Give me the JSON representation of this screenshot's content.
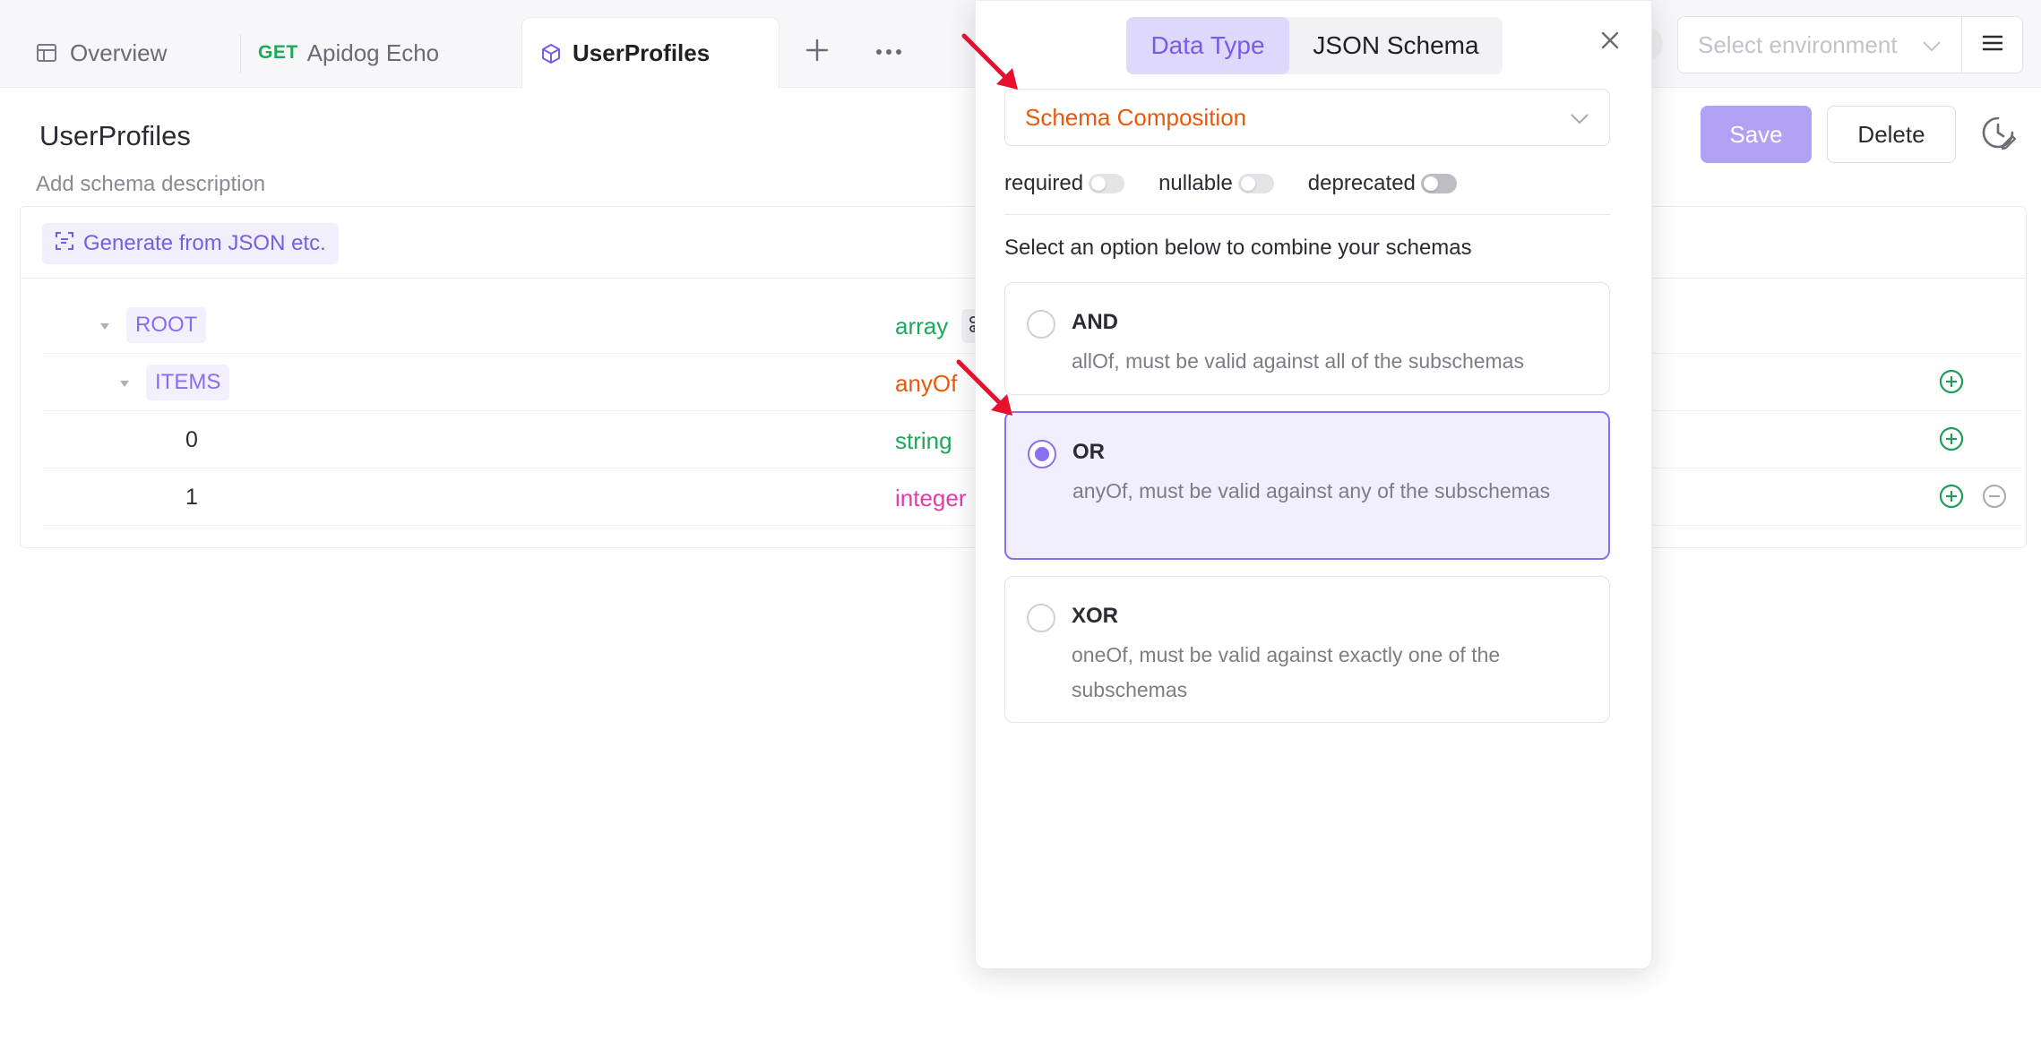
{
  "tabs": {
    "overview": "Overview",
    "echo_method": "GET",
    "echo_label": "Apidog Echo",
    "active": "UserProfiles"
  },
  "header": {
    "environment_placeholder": "Select environment"
  },
  "page": {
    "title": "UserProfiles",
    "description_placeholder": "Add schema description",
    "save_label": "Save",
    "delete_label": "Delete",
    "generate_label": "Generate from JSON etc."
  },
  "schema_rows": [
    {
      "name": "ROOT",
      "type": "array"
    },
    {
      "name": "ITEMS",
      "type": "anyOf"
    },
    {
      "name": "0",
      "type": "string"
    },
    {
      "name": "1",
      "type": "integer"
    }
  ],
  "popup": {
    "tab_data_type": "Data Type",
    "tab_json_schema": "JSON Schema",
    "selected_type": "Schema Composition",
    "flags": {
      "required": "required",
      "nullable": "nullable",
      "deprecated": "deprecated"
    },
    "combine_label": "Select an option below to combine your schemas",
    "options": [
      {
        "title": "AND",
        "desc": "allOf, must be valid against all of the subschemas",
        "selected": false
      },
      {
        "title": "OR",
        "desc": "anyOf, must be valid against any of the subschemas",
        "selected": true
      },
      {
        "title": "XOR",
        "desc": "oneOf, must be valid against exactly one of the subschemas",
        "selected": false
      }
    ]
  },
  "colors": {
    "accent": "#8b6ff0",
    "save_button": "#b1a1f3",
    "type_array": "#1ea85a",
    "type_anyof": "#e8590c",
    "type_integer": "#e03da8",
    "annotation_arrow": "#e8112d"
  },
  "icons": [
    "layout-icon",
    "cube-icon",
    "plus-icon",
    "more-icon",
    "chevron-down-icon",
    "menu-icon",
    "history-icon",
    "scan-icon",
    "caret-down-icon",
    "settings-icon",
    "add-circle-icon",
    "remove-circle-icon",
    "close-icon"
  ]
}
